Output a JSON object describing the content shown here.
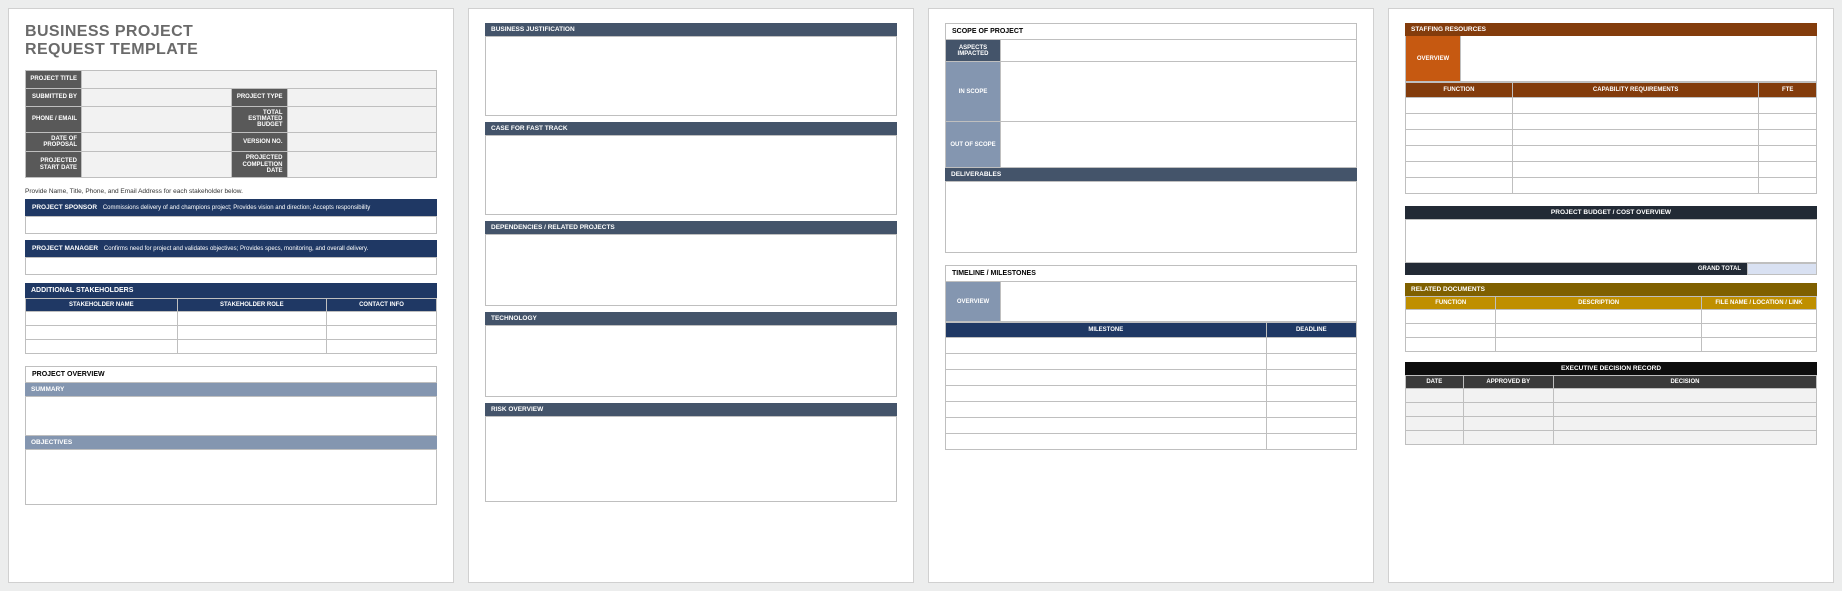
{
  "p1": {
    "title_l1": "BUSINESS PROJECT",
    "title_l2": "REQUEST TEMPLATE",
    "intake": {
      "project_title": "PROJECT TITLE",
      "submitted_by": "SUBMITTED BY",
      "project_type": "PROJECT TYPE",
      "phone_email": "PHONE / EMAIL",
      "total_budget": "TOTAL ESTIMATED BUDGET",
      "date_proposal": "DATE OF PROPOSAL",
      "version_no": "VERSION NO.",
      "proj_start": "PROJECTED START DATE",
      "proj_end": "PROJECTED COMPLETION DATE"
    },
    "instruction": "Provide Name, Title, Phone, and Email Address for each stakeholder below.",
    "sponsor_label": "PROJECT SPONSOR",
    "sponsor_sub": "Commissions delivery of and champions project; Provides vision and direction; Accepts responsibility",
    "manager_label": "PROJECT MANAGER",
    "manager_sub": "Confirms need for project and validates objectives; Provides specs, monitoring, and overall delivery.",
    "additional_sh": "ADDITIONAL STAKEHOLDERS",
    "sh_cols": {
      "name": "STAKEHOLDER NAME",
      "role": "STAKEHOLDER ROLE",
      "contact": "CONTACT INFO"
    },
    "po_head": "PROJECT OVERVIEW",
    "summary": "SUMMARY",
    "objectives": "OBJECTIVES"
  },
  "p2": {
    "business_justification": "BUSINESS JUSTIFICATION",
    "case_fast_track": "CASE FOR FAST TRACK",
    "dependencies": "DEPENDENCIES / RELATED PROJECTS",
    "technology": "TECHNOLOGY",
    "risk_overview": "RISK OVERVIEW"
  },
  "p3": {
    "scope_head": "SCOPE OF PROJECT",
    "aspects": "ASPECTS IMPACTED",
    "in_scope": "IN SCOPE",
    "out_scope": "OUT OF SCOPE",
    "deliverables": "DELIVERABLES",
    "timeline_head": "TIMELINE / MILESTONES",
    "overview": "OVERVIEW",
    "ms_cols": {
      "milestone": "MILESTONE",
      "deadline": "DEADLINE"
    }
  },
  "p4": {
    "staffing": "STAFFING RESOURCES",
    "overview": "OVERVIEW",
    "staff_cols": {
      "fn": "FUNCTION",
      "cap": "CAPABILITY REQUIREMENTS",
      "fte": "FTE"
    },
    "budget_head": "PROJECT BUDGET / COST OVERVIEW",
    "grand_total": "GRAND TOTAL",
    "related_docs": "RELATED DOCUMENTS",
    "rel_cols": {
      "fn": "FUNCTION",
      "desc": "DESCRIPTION",
      "file": "FILE NAME / LOCATION / LINK"
    },
    "edr_head": "EXECUTIVE DECISION RECORD",
    "edr_cols": {
      "date": "DATE",
      "approved": "APPROVED BY",
      "decision": "DECISION"
    }
  }
}
